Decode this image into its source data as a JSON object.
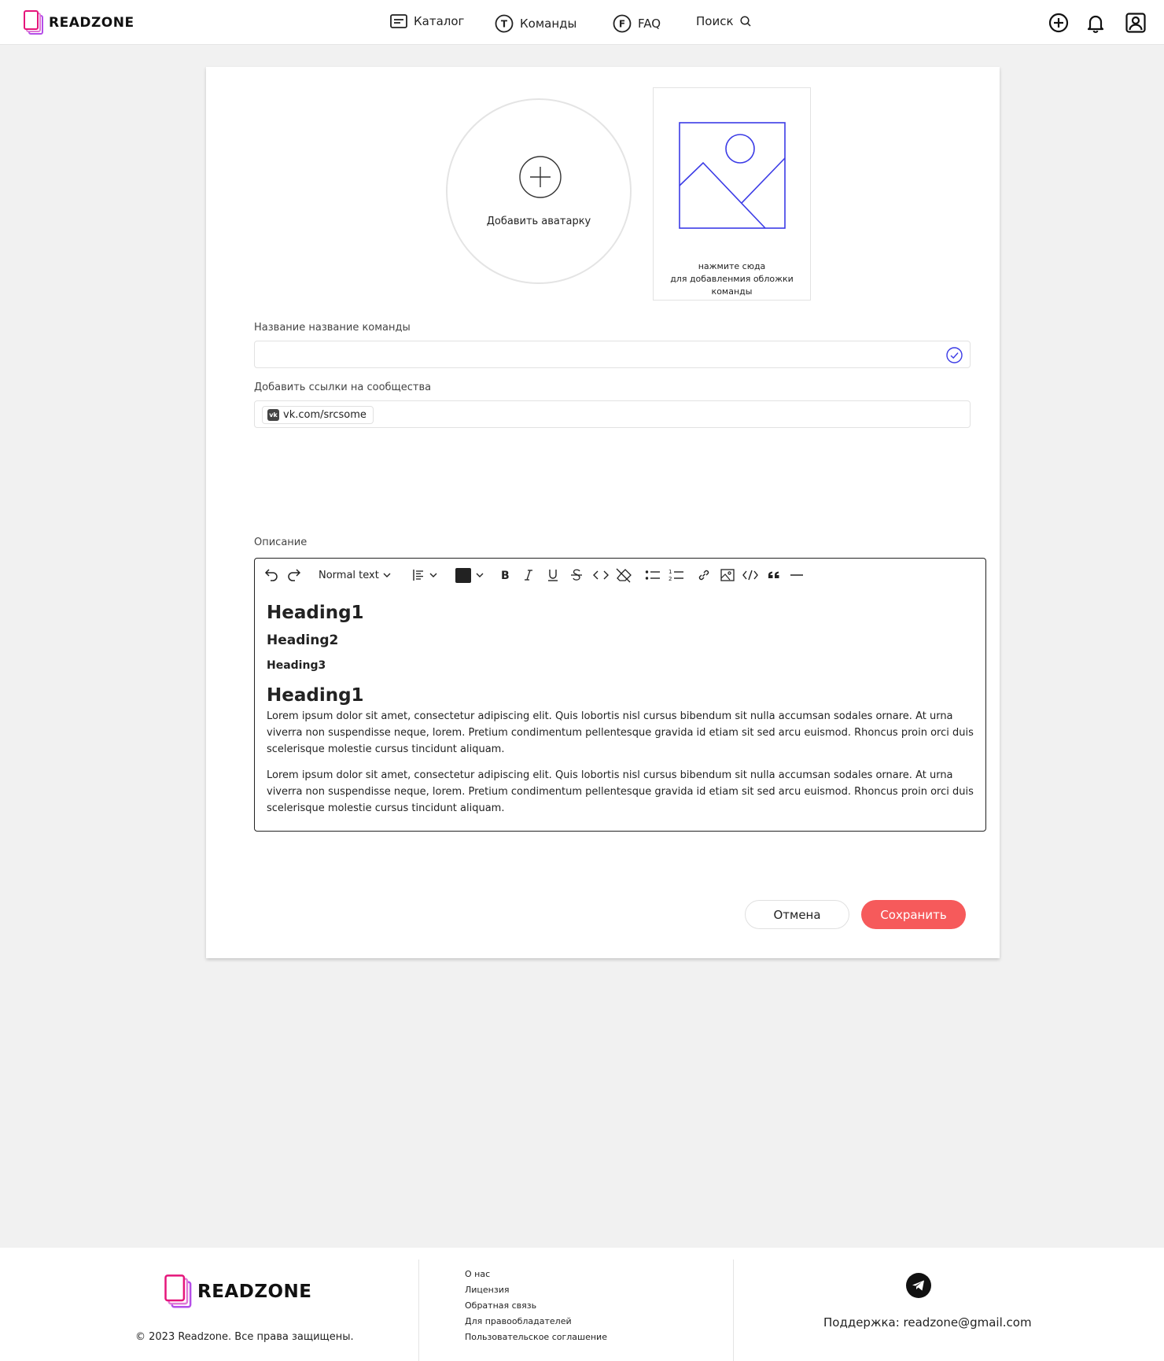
{
  "header": {
    "logo_text": "READZONE",
    "nav": [
      {
        "label": "Каталог",
        "icon": "catalog-icon"
      },
      {
        "label": "Команды",
        "icon": "teams-icon"
      },
      {
        "label": "FAQ",
        "icon": "faq-icon"
      },
      {
        "label": "Поиск",
        "icon": "search-icon"
      }
    ],
    "nav_badges": {
      "teams": "T",
      "faq": "F"
    },
    "actions": [
      "add-icon",
      "bell-icon",
      "profile-icon"
    ]
  },
  "form": {
    "avatar_label": "Добавить аватарку",
    "cover_text_line1": "нажмите сюда",
    "cover_text_line2": "для добавленмия обложки",
    "cover_text_line3": "команды",
    "team_name_label": "Название название команды",
    "team_name_value": "",
    "links_label": "Добавить ссылки на сообщества",
    "link_chip": "vk.com/srcsome",
    "vk_badge": "vk",
    "description_label": "Описание"
  },
  "editor": {
    "text_style": "Normal text",
    "toolbar": [
      "undo-icon",
      "redo-icon",
      "text-style-dropdown",
      "align-icon",
      "color-picker",
      "bold-icon",
      "italic-icon",
      "underline-icon",
      "strikethrough-icon",
      "inline-code-icon",
      "clear-format-icon",
      "bullet-list-icon",
      "numbered-list-icon",
      "link-icon",
      "image-icon",
      "code-block-icon",
      "quote-icon",
      "horizontal-rule-icon"
    ],
    "heading1": "Heading1",
    "heading2": "Heading2",
    "heading3": "Heading3",
    "heading1_second": "Heading1",
    "paragraph1": "Lorem ipsum dolor sit amet, consectetur adipiscing elit. Quis lobortis nisl cursus bibendum sit nulla accumsan sodales ornare. At urna viverra non suspendisse neque, lorem. Pretium condimentum pellentesque gravida id etiam sit sed arcu euismod. Rhoncus proin orci duis scelerisque molestie cursus tincidunt aliquam.",
    "paragraph2": "Lorem ipsum dolor sit amet, consectetur adipiscing elit. Quis lobortis nisl cursus bibendum sit nulla accumsan sodales ornare. At urna viverra non suspendisse neque, lorem. Pretium condimentum pellentesque gravida id etiam sit sed arcu euismod. Rhoncus proin orci duis scelerisque molestie cursus tincidunt aliquam."
  },
  "buttons": {
    "cancel": "Отмена",
    "save": "Сохранить"
  },
  "footer": {
    "logo_text": "READZONE",
    "copyright": "© 2023 Readzone. Все права защищены.",
    "links": [
      "О нас",
      "Лицензия",
      "Обратная связь",
      "Для правообладателей",
      "Пользовательское соглашение"
    ],
    "support": "Поддержка: readzone@gmail.com"
  },
  "colors": {
    "accent": "#f65a5b",
    "logo_pink": "#e5157a",
    "logo_purple": "#b44ee8",
    "image_placeholder_blue": "#3b3be6"
  }
}
